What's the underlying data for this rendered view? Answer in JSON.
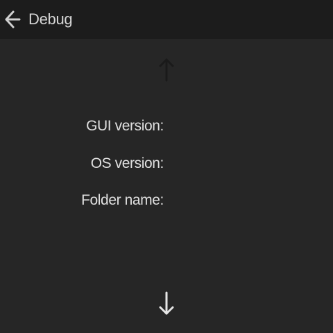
{
  "header": {
    "back_icon": "arrow-left-icon",
    "title": "Debug"
  },
  "nav": {
    "up_icon": "arrow-up-icon",
    "down_icon": "arrow-down-icon"
  },
  "info": {
    "gui_version_label": "GUI version:",
    "gui_version_value": "",
    "os_version_label": "OS version:",
    "os_version_value": "",
    "folder_name_label": "Folder name:",
    "folder_name_value": ""
  }
}
